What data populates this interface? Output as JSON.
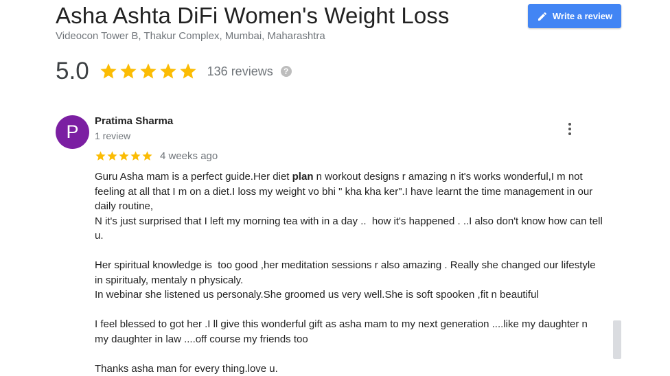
{
  "business": {
    "name": "Asha Ashta DiFi Women's Weight Loss",
    "address": "Videocon Tower B, Thakur Complex, Mumbai, Maharashtra",
    "rating": "5.0",
    "stars": 5,
    "review_count": "136 reviews"
  },
  "actions": {
    "write_review_label": "Write a review",
    "write_review_icon": "pencil-icon",
    "help_icon": "question-icon",
    "help_glyph": "?"
  },
  "review": {
    "avatar_letter": "P",
    "reviewer_name": "Pratima Sharma",
    "reviewer_meta": "1 review",
    "stars": 5,
    "date": "4 weeks ago",
    "more_icon": "more-vert-icon",
    "para1_before_highlight": "Guru Asha mam is a perfect guide.Her diet ",
    "para1_highlight": "plan",
    "para1_after_highlight": " n workout designs r amazing n it's works wonderful,I m not feeling at all that I m on a diet.I loss my weight vo bhi \" kha kha ker\".I have learnt the time management in our daily routine,",
    "para2": "N it's just surprised that I left my morning tea with in a day ..  how it's happened . ..I also don't know how can tell u.",
    "para3": "Her spiritual knowledge is  too good ,her meditation sessions r also amazing . Really she changed our lifestyle in spiritualy, mentaly n physicaly.",
    "para4": "In webinar she listened us personaly.She groomed us very well.She is soft spooken ,fit n beautiful",
    "para5": "I feel blessed to got her .I ll give this wonderful gift as asha mam to my next generation ....like my daughter n my daughter in law ....off course my friends too",
    "para6": "Thanks asha man for every thing.love u."
  },
  "colors": {
    "star": "#fbbc04",
    "avatar_bg": "#7b1fa2",
    "button_bg": "#4285f4"
  }
}
